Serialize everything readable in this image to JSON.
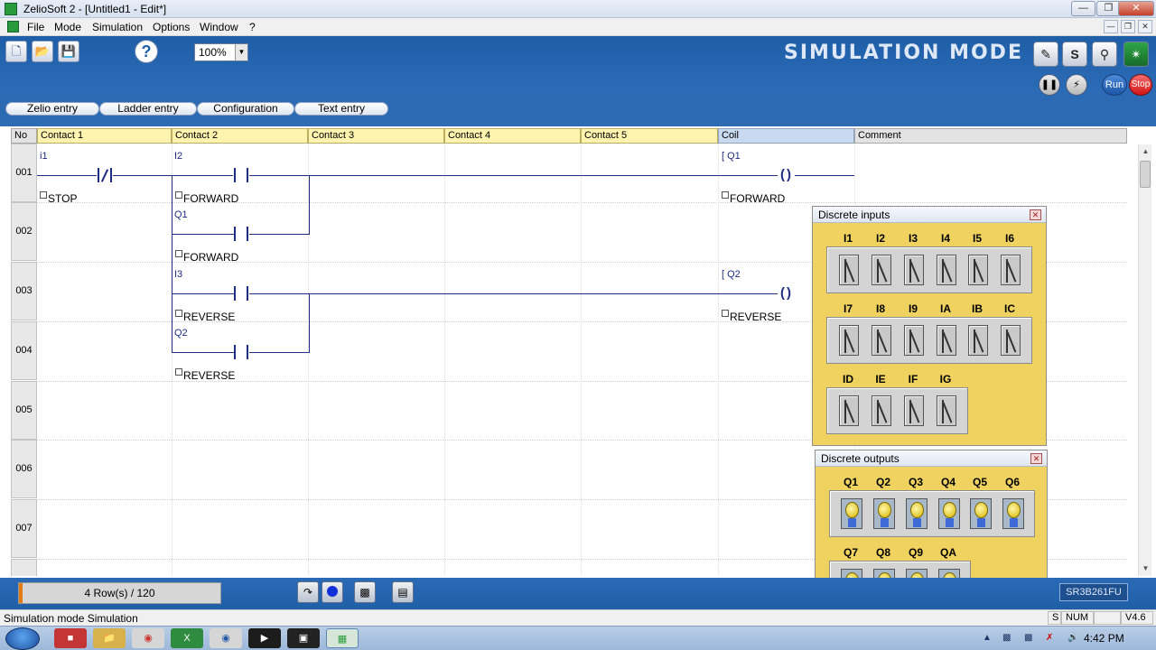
{
  "window": {
    "title": "ZelioSoft 2 - [Untitled1 - Edit*]"
  },
  "menu": {
    "items": [
      "File",
      "Mode",
      "Simulation",
      "Options",
      "Window",
      "?"
    ]
  },
  "toolbar": {
    "zoom": "100%",
    "mode_label": "SIMULATION MODE",
    "run_label": "Run",
    "stop_label": "Stop",
    "tabs": [
      "Zelio entry",
      "Ladder entry",
      "Configuration",
      "Text entry"
    ]
  },
  "grid": {
    "headers": {
      "no": "No",
      "contact1": "Contact 1",
      "contact2": "Contact 2",
      "contact3": "Contact 3",
      "contact4": "Contact 4",
      "contact5": "Contact 5",
      "coil": "Coil",
      "comment": "Comment"
    },
    "row_numbers": [
      "001",
      "002",
      "003",
      "004",
      "005",
      "006",
      "007"
    ],
    "rung": {
      "r1": {
        "c1_addr": "i1",
        "c1_comment": "STOP",
        "c2_addr": "I2",
        "c2_comment": "FORWARD",
        "coil_addr": "Q1",
        "coil_comment": "FORWARD"
      },
      "r2": {
        "c2_addr": "Q1",
        "c2_comment": "FORWARD"
      },
      "r3": {
        "c2_addr": "I3",
        "c2_comment": "REVERSE",
        "coil_addr": "Q2",
        "coil_comment": "REVERSE"
      },
      "r4": {
        "c2_addr": "Q2",
        "c2_comment": "REVERSE"
      }
    }
  },
  "discrete_inputs": {
    "title": "Discrete inputs",
    "row1": [
      "I1",
      "I2",
      "I3",
      "I4",
      "I5",
      "I6"
    ],
    "row2": [
      "I7",
      "I8",
      "I9",
      "IA",
      "IB",
      "IC"
    ],
    "row3": [
      "ID",
      "IE",
      "IF",
      "IG"
    ]
  },
  "discrete_outputs": {
    "title": "Discrete outputs",
    "row1": [
      "Q1",
      "Q2",
      "Q3",
      "Q4",
      "Q5",
      "Q6"
    ],
    "row2": [
      "Q7",
      "Q8",
      "Q9",
      "QA"
    ]
  },
  "bottom": {
    "rows_info": "4 Row(s) / 120",
    "module": "SR3B261FU"
  },
  "status": {
    "message": "Simulation mode Simulation",
    "num": "NUM",
    "version": "V4.6",
    "s": "S"
  },
  "taskbar": {
    "time": "4:42 PM"
  },
  "colors": {
    "toolbar_blue": "#2b6ab5",
    "panel_yellow": "#efd25f",
    "wire_blue": "#1e2d80"
  }
}
